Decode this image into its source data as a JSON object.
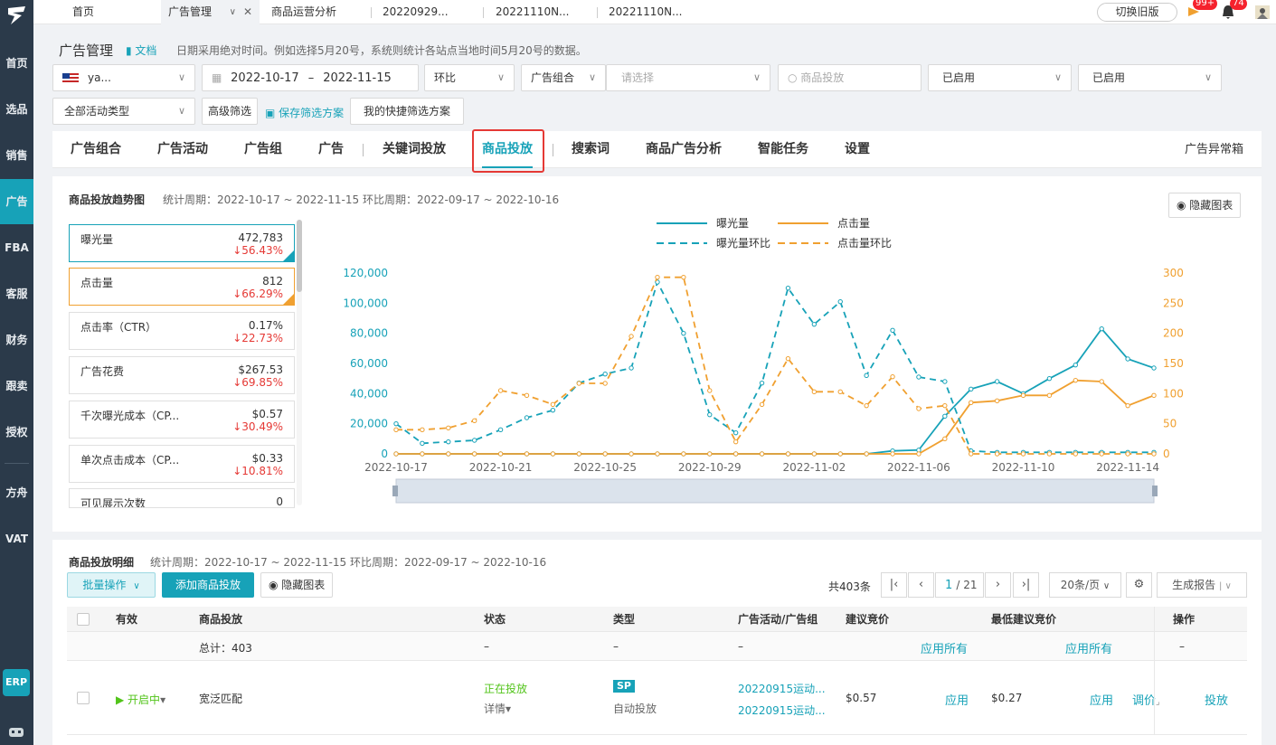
{
  "sidebar": {
    "items": [
      "首页",
      "选品",
      "销售",
      "广告",
      "FBA",
      "客服",
      "财务",
      "跟卖",
      "授权",
      "方舟",
      "VAT"
    ],
    "erp": "ERP"
  },
  "tabs": [
    {
      "label": "首页"
    },
    {
      "label": "广告管理"
    },
    {
      "label": "商品运营分析"
    },
    {
      "label": "20220929..."
    },
    {
      "label": "20221110N..."
    },
    {
      "label": "20221110N..."
    }
  ],
  "topbar": {
    "old_version": "切换旧版",
    "badge1": "99+",
    "badge2": "74"
  },
  "header": {
    "title": "广告管理",
    "doc": "文档",
    "hint": "日期采用绝对时间。例如选择5月20号，系统则统计各站点当地时间5月20号的数据。"
  },
  "filters": {
    "shop": "ya...",
    "date_start": "2022-10-17",
    "date_sep": "–",
    "date_end": "2022-11-15",
    "compare": "环比",
    "group_type": "广告组合",
    "group_placeholder": "请选择",
    "search_placeholder": "商品投放",
    "status1": "已启用",
    "status2": "已启用",
    "activity_type": "全部活动类型",
    "advanced": "高级筛选",
    "save_scheme": "保存筛选方案",
    "quick_scheme": "我的快捷筛选方案"
  },
  "nav": {
    "items": [
      "广告组合",
      "广告活动",
      "广告组",
      "广告",
      "关键词投放",
      "商品投放",
      "搜索词",
      "商品广告分析",
      "智能任务",
      "设置"
    ],
    "right": "广告异常箱"
  },
  "trend": {
    "title": "商品投放趋势图",
    "period": "统计周期：2022-10-17 ~ 2022-11-15  环比周期：2022-09-17 ~ 2022-10-16",
    "hide_chart": "隐藏图表",
    "metrics": [
      {
        "name": "曝光量",
        "value": "472,783",
        "delta": "↓56.43%"
      },
      {
        "name": "点击量",
        "value": "812",
        "delta": "↓66.29%"
      },
      {
        "name": "点击率（CTR）",
        "value": "0.17%",
        "delta": "↓22.73%"
      },
      {
        "name": "广告花费",
        "value": "$267.53",
        "delta": "↓69.85%"
      },
      {
        "name": "千次曝光成本（CP...",
        "value": "$0.57",
        "delta": "↓30.49%"
      },
      {
        "name": "单次点击成本（CP...",
        "value": "$0.33",
        "delta": "↓10.81%"
      },
      {
        "name": "可见展示次数",
        "value": "0",
        "delta": ""
      }
    ]
  },
  "chart_data": {
    "type": "line",
    "title": "",
    "x": [
      "2022-10-17",
      "2022-10-18",
      "2022-10-19",
      "2022-10-20",
      "2022-10-21",
      "2022-10-22",
      "2022-10-23",
      "2022-10-24",
      "2022-10-25",
      "2022-10-26",
      "2022-10-27",
      "2022-10-28",
      "2022-10-29",
      "2022-10-30",
      "2022-10-31",
      "2022-11-01",
      "2022-11-02",
      "2022-11-03",
      "2022-11-04",
      "2022-11-05",
      "2022-11-06",
      "2022-11-07",
      "2022-11-08",
      "2022-11-09",
      "2022-11-10",
      "2022-11-11",
      "2022-11-12",
      "2022-11-13",
      "2022-11-14",
      "2022-11-15"
    ],
    "x_tick_labels": [
      "2022-10-17",
      "2022-10-21",
      "2022-10-25",
      "2022-10-29",
      "2022-11-02",
      "2022-11-06",
      "2022-11-10",
      "2022-11-14"
    ],
    "y_left_ticks": [
      "0",
      "20,000",
      "40,000",
      "60,000",
      "80,000",
      "100,000",
      "120,000"
    ],
    "y_right_ticks": [
      "0",
      "50",
      "100",
      "150",
      "200",
      "250",
      "300"
    ],
    "ylim_left": [
      0,
      120000
    ],
    "ylim_right": [
      0,
      300
    ],
    "colors": {
      "impressions": "#17a2b8",
      "clicks": "#f0a030"
    },
    "series": [
      {
        "name": "曝光量",
        "axis": "left",
        "style": "solid",
        "color": "#17a2b8",
        "values": [
          0,
          0,
          0,
          0,
          0,
          0,
          0,
          0,
          0,
          0,
          0,
          0,
          0,
          0,
          0,
          0,
          0,
          0,
          0,
          2000,
          2500,
          25000,
          43000,
          48000,
          40000,
          50000,
          59000,
          83000,
          63000,
          57000
        ]
      },
      {
        "name": "点击量",
        "axis": "right",
        "style": "solid",
        "color": "#f0a030",
        "values": [
          0,
          0,
          0,
          0,
          0,
          0,
          0,
          0,
          0,
          0,
          0,
          0,
          0,
          0,
          0,
          0,
          0,
          0,
          0,
          0,
          0,
          25,
          85,
          88,
          97,
          97,
          122,
          120,
          80,
          97
        ]
      },
      {
        "name": "曝光量环比",
        "axis": "left",
        "style": "dashed",
        "color": "#17a2b8",
        "values": [
          20000,
          7000,
          8000,
          9000,
          16000,
          24000,
          29000,
          47000,
          53000,
          57000,
          114000,
          80000,
          26000,
          14000,
          47000,
          110000,
          86000,
          101000,
          52000,
          82000,
          51000,
          48000,
          2000,
          1000,
          1000,
          1000,
          1000,
          1000,
          1000,
          1000
        ]
      },
      {
        "name": "点击量环比",
        "axis": "right",
        "style": "dashed",
        "color": "#f0a030",
        "values": [
          40,
          40,
          43,
          55,
          105,
          97,
          82,
          117,
          117,
          195,
          293,
          293,
          105,
          20,
          82,
          158,
          103,
          103,
          80,
          128,
          75,
          80,
          0,
          0,
          0,
          0,
          0,
          0,
          0,
          0
        ]
      }
    ],
    "legend_position": "top-center"
  },
  "table": {
    "title": "商品投放明细",
    "period": "统计周期：2022-10-17 ~ 2022-11-15  环比周期：2022-09-17 ~ 2022-10-16",
    "batch": "批量操作",
    "add": "添加商品投放",
    "hide_chart": "隐藏图表",
    "total_count": "共403条",
    "page_current": "1",
    "page_total": "/ 21",
    "page_size": "20条/页",
    "report": "生成报告",
    "headers": [
      "有效",
      "商品投放",
      "状态",
      "类型",
      "广告活动/广告组",
      "建议竞价",
      "最低建议竞价",
      "操作"
    ],
    "total_row": {
      "label": "总计：403",
      "dash": "–",
      "apply_all": "应用所有"
    },
    "row": {
      "valid": "开启中",
      "targeting": "宽泛匹配",
      "status": "正在投放",
      "status_detail": "详情",
      "type_tag": "SP",
      "type": "自动投放",
      "campaign": "20220915运动...",
      "adgroup": "20220915运动...",
      "bid": "$0.57",
      "apply": "应用",
      "min_bid": "$0.27",
      "min_apply": "应用",
      "adjust": "调价",
      "deliver": "投放"
    }
  }
}
